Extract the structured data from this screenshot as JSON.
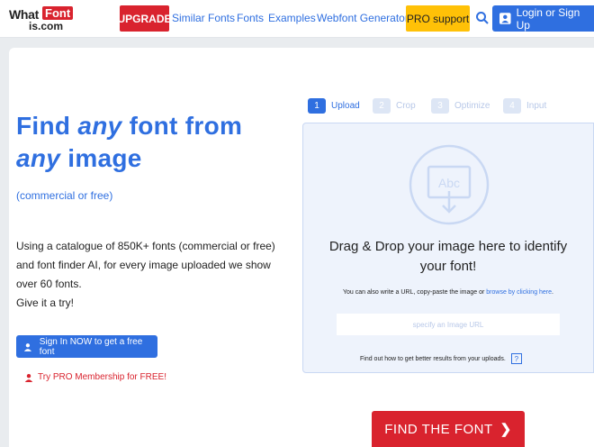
{
  "header": {
    "logo": {
      "part1": "What",
      "part2": "Font",
      "part3": "is.com"
    },
    "upgrade": "UPGRADE",
    "nav": [
      "Similar Fonts",
      "Fonts",
      "Examples",
      "Webfont Generator"
    ],
    "pro": "PRO support",
    "login": "Login or Sign Up"
  },
  "hero": {
    "title_part1": "Find ",
    "title_em1": "any",
    "title_part2": " font from",
    "title_em2": "any",
    "title_part3": " image",
    "subtitle": "(commercial or free)",
    "desc_lines": [
      "Using a catalogue of 850K+ fonts (commercial or free)",
      "and font finder AI, for every image uploaded we show",
      "over 60 fonts.",
      "Give it a try!"
    ],
    "signin": "Sign In NOW to get a free font",
    "trypro": "Try PRO Membership for FREE!"
  },
  "uploader": {
    "steps": [
      {
        "num": "1",
        "label": "Upload"
      },
      {
        "num": "2",
        "label": "Crop"
      },
      {
        "num": "3",
        "label": "Optimize"
      },
      {
        "num": "4",
        "label": "Input"
      }
    ],
    "icon_text": "Abc",
    "drop_line1": "Drag & Drop your image here to identify",
    "drop_line2": "your font!",
    "alt_text": "You can also write a URL, copy-paste the image or ",
    "alt_link": "browse by clicking here",
    "alt_end": ".",
    "url_placeholder": "specify an Image URL",
    "help_text": "Find out how to get better results from your uploads.",
    "help_icon": "?",
    "find_button": "FIND THE FONT"
  },
  "colors": {
    "brand_blue": "#2f6fe0",
    "brand_red": "#d9232e",
    "pro_yellow": "#ffc107"
  }
}
